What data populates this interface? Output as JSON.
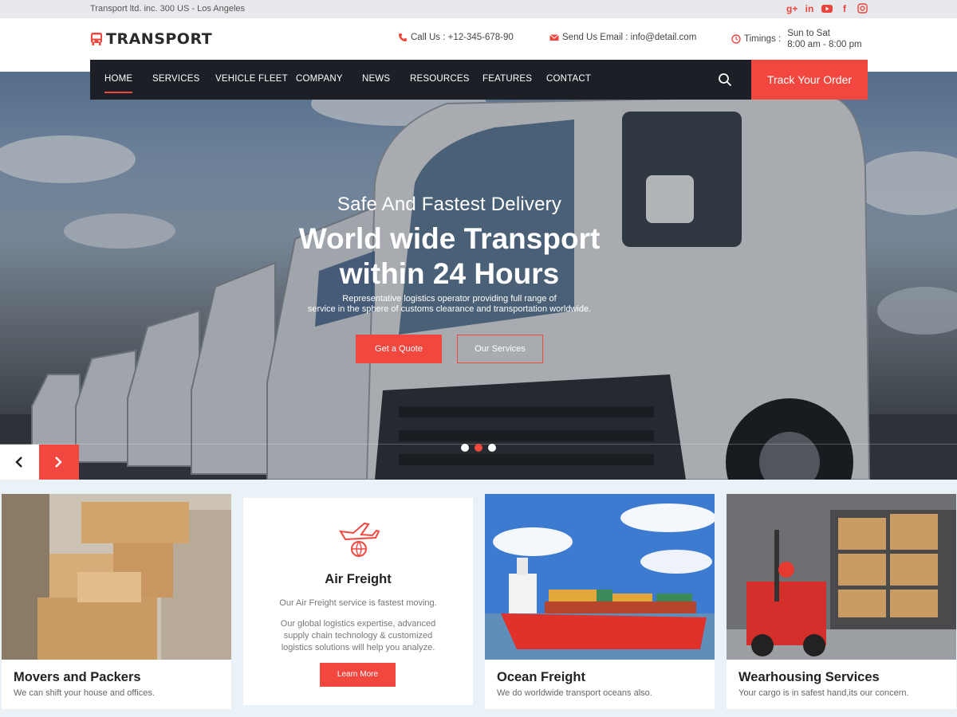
{
  "topbar": {
    "address": "Transport ltd. inc. 300 US - Los Angeles",
    "social": [
      "google-plus-icon",
      "linkedin-icon",
      "youtube-icon",
      "facebook-icon",
      "instagram-icon"
    ]
  },
  "header": {
    "logo_text": "TRANSPORT",
    "call_label": "Call Us : +12-345-678-90",
    "email_label": "Send Us Email : info@detail.com",
    "timings_label": "Timings :",
    "timings_days": "Sun to Sat",
    "timings_hours": "8:00 am - 8:00 pm"
  },
  "nav": {
    "items": [
      "HOME",
      "SERVICES",
      "VEHICLE FLEET",
      "COMPANY",
      "NEWS",
      "RESOURCES",
      "FEATURES",
      "CONTACT"
    ],
    "active": "HOME",
    "track_button": "Track Your Order"
  },
  "hero": {
    "subtitle": "Safe And Fastest Delivery",
    "title_line1": "World wide Transport",
    "title_line2": "within 24 Hours",
    "desc_line1": "Representative logistics operator providing full range of",
    "desc_line2": "service in the sphere of customs clearance and transportation worldwide.",
    "btn_quote": "Get a Quote",
    "btn_services": "Our Services",
    "slides_total": 3,
    "slide_active": 2
  },
  "services": {
    "cards": [
      {
        "title": "Movers and Packers",
        "subtitle": "We can shift your house and offices."
      },
      {
        "title": "Air Freight",
        "p1": "Our Air Freight service is fastest moving.",
        "p2": "Our global logistics expertise, advanced supply chain technology & customized logistics solutions will help you analyze.",
        "button": "Learn More"
      },
      {
        "title": "Ocean Freight",
        "subtitle": "We do worldwide transport oceans also."
      },
      {
        "title": "Wearhousing Services",
        "subtitle": "Your cargo is in safest hand,its our concern."
      }
    ]
  },
  "colors": {
    "accent": "#f2473f",
    "nav_bg": "#1c1f26",
    "section_bg": "#eaf2f8"
  }
}
